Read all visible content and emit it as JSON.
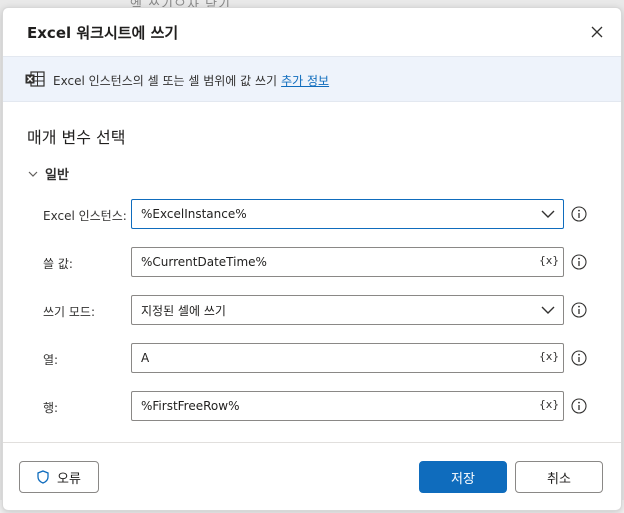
{
  "backdrop": {
    "top_text": "엑 쓰기으자 닫기"
  },
  "dialog": {
    "title": "Excel 워크시트에 쓰기",
    "close_icon": "close-icon"
  },
  "banner": {
    "icon": "excel-icon",
    "text": "Excel 인스턴스의 셀 또는 셀 범위에 값 쓰기",
    "link": "추가 정보"
  },
  "section": {
    "title": "매개 변수 선택"
  },
  "group": {
    "label": "일반",
    "icon": "chevron-down-icon"
  },
  "fields": [
    {
      "label": "Excel 인스턴스:",
      "value": "%ExcelInstance%",
      "type": "select"
    },
    {
      "label": "쓸 값:",
      "value": "%CurrentDateTime%",
      "type": "text",
      "var_button": "{x}"
    },
    {
      "label": "쓰기 모드:",
      "value": "지정된 셀에 쓰기",
      "type": "select"
    },
    {
      "label": "열:",
      "value": "A",
      "type": "text",
      "var_button": "{x}"
    },
    {
      "label": "행:",
      "value": "%FirstFreeRow%",
      "type": "text",
      "var_button": "{x}"
    }
  ],
  "footer": {
    "error_label": "오류",
    "error_icon": "shield-icon",
    "save_label": "저장",
    "cancel_label": "취소"
  },
  "colors": {
    "accent": "#0f6cbd",
    "banner_bg": "#eef3fb"
  }
}
